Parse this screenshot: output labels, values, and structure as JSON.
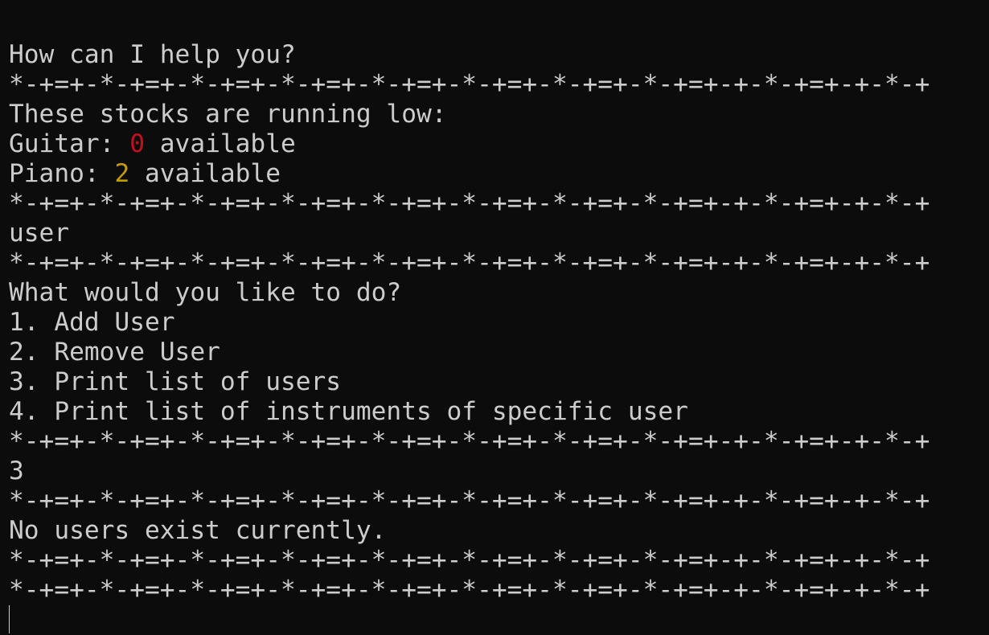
{
  "terminal": {
    "separator": "*-+=+-*-+=+-*-+=+-*-+=+-*-+=+-*-+=+-*-+=+-*-+=+-+-*-+=+-+-*-+",
    "prompt_help": "How can I help you?",
    "low_stock_header": "These stocks are running low:",
    "stock_items": [
      {
        "name": "Guitar: ",
        "count": "0",
        "suffix": " available",
        "color": "#c50f1f"
      },
      {
        "name": "Piano: ",
        "count": "2",
        "suffix": " available",
        "color": "#c19c00"
      }
    ],
    "section_name": "user",
    "menu_question": "What would you like to do?",
    "menu_options": [
      "1. Add User",
      "2. Remove User",
      "3. Print list of users",
      "4. Print list of instruments of specific user"
    ],
    "user_input": "3",
    "result_message": "No users exist currently."
  },
  "colors": {
    "background": "#0c0c0c",
    "foreground": "#cccccc",
    "red": "#c50f1f",
    "yellow": "#c19c00"
  }
}
